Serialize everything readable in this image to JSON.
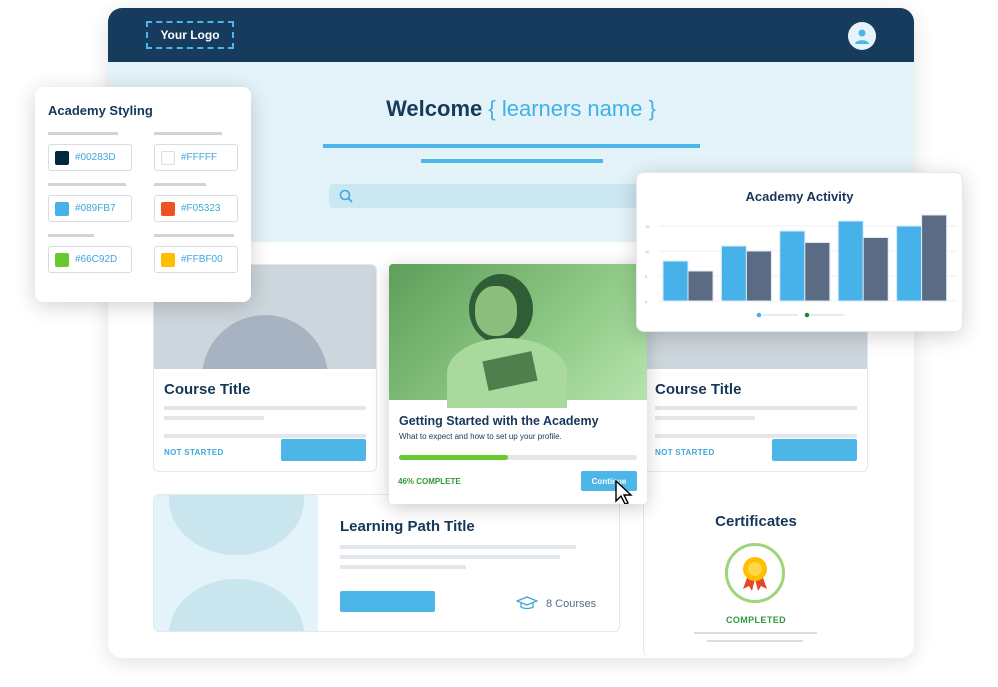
{
  "header": {
    "logo": "Your Logo",
    "avatar_icon": "user-icon"
  },
  "hero": {
    "welcome": "Welcome",
    "name_placeholder": "{ learners name }",
    "search_icon": "search-icon"
  },
  "styling": {
    "title": "Academy Styling",
    "colors": [
      "#00283D",
      "#FFFFF",
      "#089FB7",
      "#F05323",
      "#66C92D",
      "#FFBF00"
    ],
    "swatches": [
      "#00283D",
      "#FFFFFF",
      "#47B2EA",
      "#F05323",
      "#66C92D",
      "#FFBF00"
    ]
  },
  "courses": [
    {
      "title": "Course Title",
      "status": "NOT STARTED"
    },
    {
      "title": "Course Title",
      "status": "NOT STARTED"
    }
  ],
  "featured": {
    "title": "Getting Started with the Academy",
    "subtitle": "What to expect and how to set up your profile.",
    "progress": 46,
    "progress_label": "46% COMPLETE",
    "button": "Continue"
  },
  "learning_path": {
    "title": "Learning Path Title",
    "courses": "8 Courses",
    "icon": "graduation-cap-icon"
  },
  "certificates": {
    "title": "Certificates",
    "status": "COMPLETED",
    "icon": "award-ribbon-icon"
  },
  "chart_data": {
    "type": "bar",
    "title": "Academy Activity",
    "yticks": [
      "0",
      "5",
      "10",
      "15"
    ],
    "ylim": [
      0,
      18
    ],
    "grid": true,
    "legend": "bottom-center",
    "series": [
      {
        "color": "#47B2EA",
        "values": [
          8,
          11,
          14,
          16,
          15
        ]
      },
      {
        "color": "#5A6B83",
        "values": [
          6,
          10,
          11.7,
          12.7,
          17.2
        ]
      }
    ]
  }
}
